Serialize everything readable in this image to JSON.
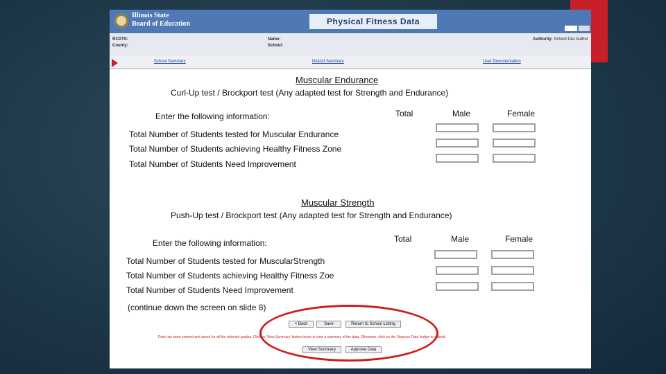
{
  "header": {
    "org_line1": "Illinois State",
    "org_line2": "Board of Education",
    "app_title": "Physical Fitness Data"
  },
  "info": {
    "rcdts_label": "RCDTS:",
    "county_label": "County:",
    "name_label": "Name:",
    "school_label": "School:",
    "authority_label": "Authority:",
    "authority_value": "School Dist Author"
  },
  "links": [
    "School Summary",
    "District Summary",
    "User Documentation"
  ],
  "endurance": {
    "title": "Muscular Endurance",
    "subtitle": "Curl-Up test / Brockport test (Any adapted test for Strength and Endurance)",
    "enter": "Enter the following information:",
    "columns": [
      "Total",
      "Male",
      "Female"
    ],
    "rows": [
      "Total Number of Students tested for Muscular Endurance",
      "Total Number of Students achieving Healthy Fitness Zone",
      "Total Number of Students Need Improvement"
    ]
  },
  "strength": {
    "title": "Muscular Strength",
    "subtitle": "Push-Up test / Brockport test (Any adapted test for Strength and Endurance)",
    "enter": "Enter the following information:",
    "columns": [
      "Total",
      "Male",
      "Female"
    ],
    "rows": [
      "Total Number of Students tested for MuscularStrength",
      "Total Number of Students achieving Healthy Fitness Zoe",
      "Total Number of Students Need Improvement"
    ]
  },
  "continue_note": "(continue down the screen on slide 8)",
  "buttons": {
    "back": "< Back",
    "save": "Save",
    "return": "Return to School Listing",
    "view_summary": "View Summary",
    "approve": "Approve Data"
  },
  "notice": "Data has been entered and saved for all the selected grades. Click on 'View Summary' button below to view a summary of the data. Otherwise, click on the 'Approve Data' button to submit.",
  "colors": {
    "accent_red": "#c8202a",
    "header_blue": "#4f79b4",
    "link_blue": "#1a3fa0"
  }
}
